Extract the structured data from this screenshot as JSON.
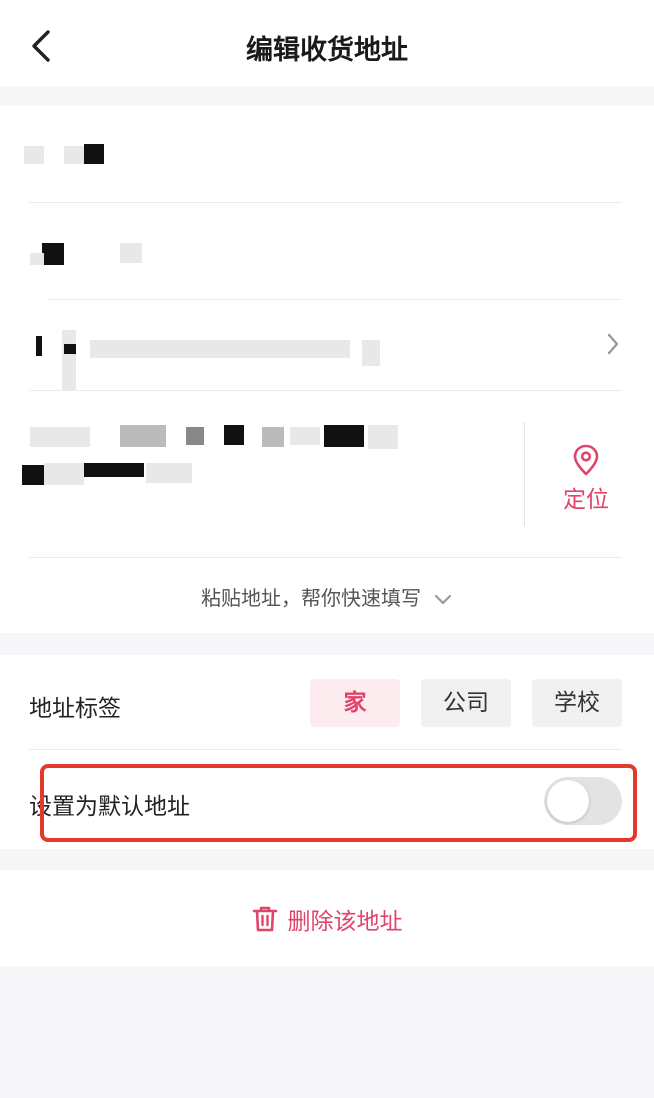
{
  "header": {
    "title": "编辑收货地址",
    "back_icon": "chevron-left-icon"
  },
  "address_form": {
    "name_value": "",
    "phone_value": "15██ ████ ██42",
    "region_value": "██市 上海市 浦东新区 川██镇",
    "detail_line1": "上海市浦████████路████花园",
    "detail_line2": "█区 15 号楼 202",
    "locate_label": "定位",
    "paste_hint": "粘贴地址，帮你快速填写"
  },
  "tags": {
    "label": "地址标签",
    "options": [
      "家",
      "公司",
      "学校"
    ],
    "selected": "家"
  },
  "default_toggle": {
    "label": "设置为默认地址",
    "on": false
  },
  "delete": {
    "label": "删除该地址"
  },
  "colors": {
    "accent": "#e0446a",
    "highlight": "#e23a2c",
    "background": "#f6f6f8"
  }
}
